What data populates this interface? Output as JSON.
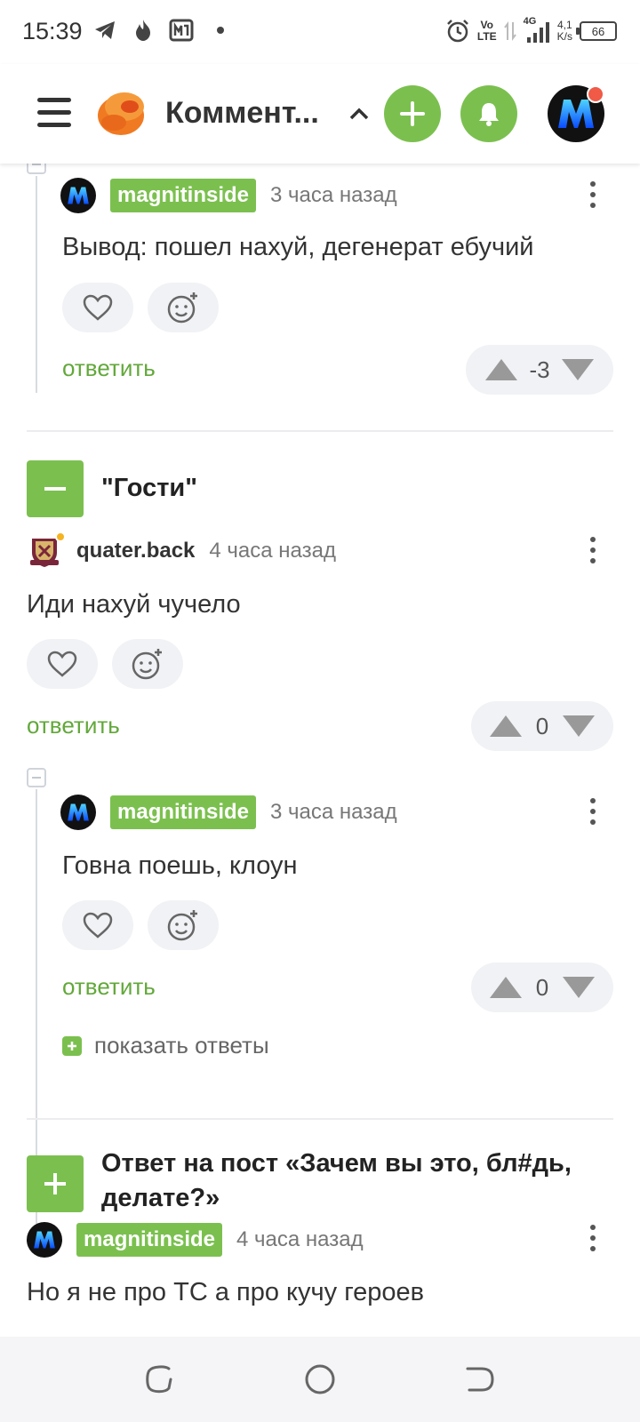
{
  "status_bar": {
    "time": "15:39",
    "volte": "Vo\nLTE",
    "signal": "4G",
    "speed_value": "4,1",
    "speed_unit": "K/s",
    "battery": "66"
  },
  "header": {
    "title": "Коммент...",
    "accent_color": "#7bc04f",
    "icons": [
      "menu-icon",
      "logo-icon",
      "chevron-up-icon",
      "plus-icon",
      "bell-icon",
      "avatar"
    ]
  },
  "comments": [
    {
      "author": "magnitinside",
      "time": "3 часа назад",
      "text": "Вывод: пошел нахуй, дегенерат ебучий",
      "reply_label": "ответить",
      "rating": "-3"
    },
    {
      "author": "quater.back",
      "time": "4 часа назад",
      "text": "Иди нахуй чучело",
      "reply_label": "ответить",
      "rating": "0"
    },
    {
      "author": "magnitinside",
      "time": "3 часа назад",
      "text": "Говна поешь, клоун",
      "reply_label": "ответить",
      "rating": "0",
      "show_replies": "показать ответы"
    },
    {
      "author": "magnitinside",
      "time": "4 часа назад",
      "text": "Но я не про ТС а про кучу героев"
    }
  ],
  "posts": [
    {
      "title": "\"Гости\""
    },
    {
      "title_line1": "Ответ на пост «Зачем вы это, бл#дь,",
      "title_line2": "делате?»"
    }
  ]
}
